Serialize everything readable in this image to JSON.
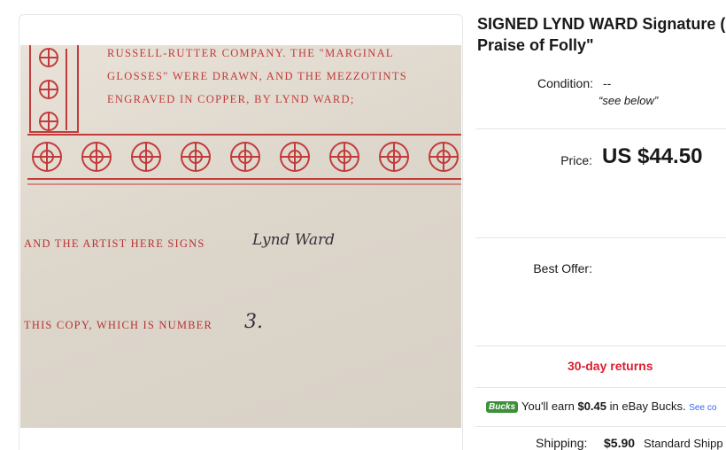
{
  "listing": {
    "title_line1": "SIGNED LYND WARD Signature (",
    "title_line2": "Praise of Folly\""
  },
  "image": {
    "verse_line1": "RUSSELL-RUTTER COMPANY. THE \"MARGINAL",
    "verse_line2": "GLOSSES\" WERE DRAWN, AND THE MEZZOTINTS",
    "verse_line3": "ENGRAVED IN COPPER, BY LYND WARD;",
    "sign_text": "AND THE ARTIST HERE SIGNS",
    "signature": "Lynd Ward",
    "copy_text": "THIS COPY, WHICH IS NUMBER",
    "copy_number": "3.",
    "ink_color": "#c23b3b"
  },
  "condition": {
    "label": "Condition:",
    "value": "--",
    "note": "see below"
  },
  "price": {
    "label": "Price:",
    "value": "US $44.50"
  },
  "best_offer": {
    "label": "Best Offer:"
  },
  "returns": {
    "text": "30-day returns",
    "color": "#dd1e31"
  },
  "bucks": {
    "logo": "Bucks",
    "prefix": "You'll earn ",
    "amount": "$0.45",
    "suffix": " in eBay Bucks.",
    "link": "See co"
  },
  "shipping": {
    "label": "Shipping:",
    "cost": "$5.90",
    "method": "Standard Shipp"
  }
}
